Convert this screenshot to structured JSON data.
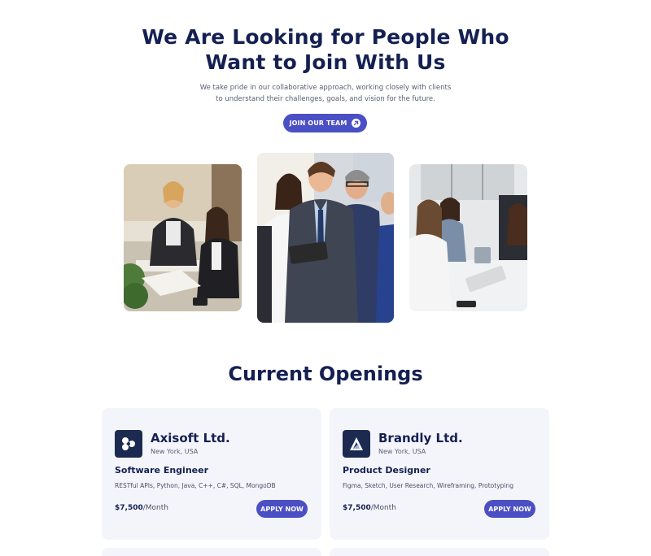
{
  "hero": {
    "title_line1": "We Are Looking for People Who",
    "title_line2": "Want to Join With Us",
    "subtitle_line1": "We take pride in our collaborative approach, working closely with clients",
    "subtitle_line2": "to understand their challenges, goals, and vision for the future.",
    "cta_label": "JOIN OUR TEAM",
    "cta_icon": "arrow-up-right-icon",
    "accent_color": "#4b4fc4",
    "title_color": "#152052"
  },
  "photos": [
    {
      "name": "team-meeting-photo"
    },
    {
      "name": "business-team-photo"
    },
    {
      "name": "office-workers-photo"
    }
  ],
  "openings": {
    "title": "Current Openings",
    "cards": [
      {
        "company": "Axisoft Ltd.",
        "location": "New York, USA",
        "role": "Software Engineer",
        "skills": "RESTful APIs, Python, Java, C++, C#, SQL, MongoDB",
        "salary": "$7,500",
        "period": "/Month",
        "apply_label": "APPLY NOW",
        "logo_icon": "axisoft-logo-icon"
      },
      {
        "company": "Brandly Ltd.",
        "location": "New York, USA",
        "role": "Product Designer",
        "skills": "Figma, Sketch, User Research, Wireframing, Prototyping",
        "salary": "$7,500",
        "period": "/Month",
        "apply_label": "APPLY NOW",
        "logo_icon": "brandly-logo-icon"
      }
    ]
  }
}
